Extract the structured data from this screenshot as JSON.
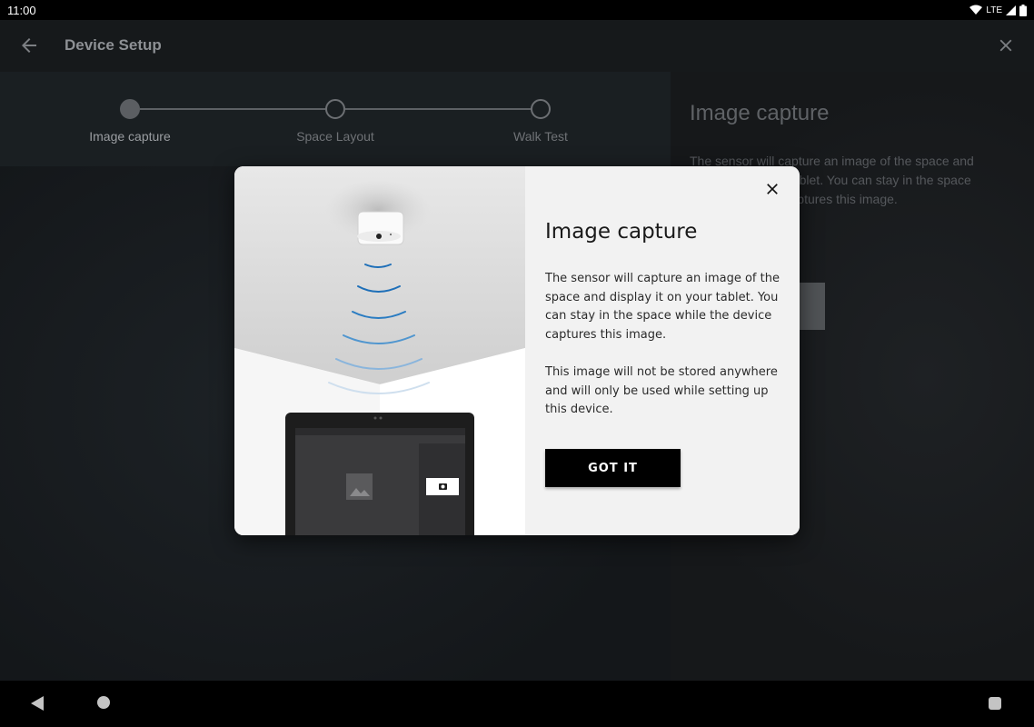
{
  "status_bar": {
    "time": "11:00",
    "network": "LTE"
  },
  "app_bar": {
    "title": "Device Setup"
  },
  "stepper": {
    "steps": [
      {
        "label": "Image capture",
        "active": true
      },
      {
        "label": "Space Layout",
        "active": false
      },
      {
        "label": "Walk Test",
        "active": false
      }
    ]
  },
  "side_panel": {
    "title": "Image capture",
    "text": "The sensor will capture an image of the space and display it on your tablet. You can stay in the space while the device captures this image."
  },
  "dialog": {
    "title": "Image capture",
    "paragraph1": "The sensor will capture an image of the space and display it on your tablet. You can stay in the space while the device captures this image.",
    "paragraph2": "This image will not be stored anywhere and will only be used while setting up this device.",
    "button_label": "GOT IT"
  },
  "colors": {
    "accent_wave": "#1e6fb8",
    "dialog_bg": "#f2f2f2",
    "button_bg": "#000000"
  }
}
